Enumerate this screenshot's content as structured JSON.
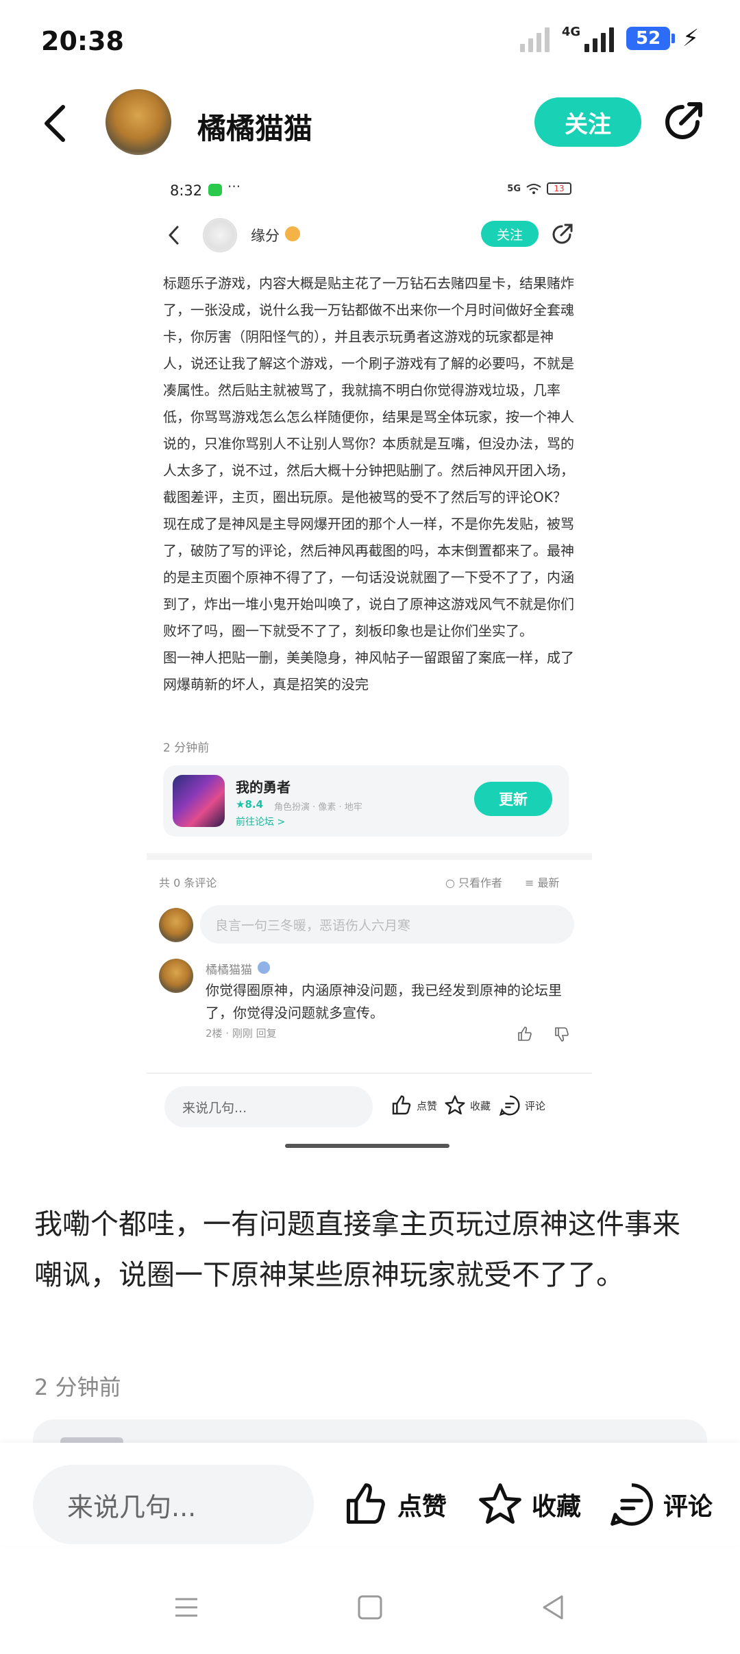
{
  "status_bar": {
    "time": "20:38",
    "network_label": "4G",
    "battery": "52",
    "icons": [
      "signal-icon",
      "mobile-data-icon",
      "battery-icon",
      "charging-icon"
    ]
  },
  "header": {
    "author_name": "橘橘猫猫",
    "follow_label": "关注",
    "icons": [
      "back-icon",
      "avatar",
      "share-icon"
    ]
  },
  "embedded_screenshot": {
    "time": "8:32",
    "dots": "···",
    "network": "5G",
    "battery": "13",
    "author_name": "缘分",
    "follow_label": "关注",
    "body_paragraphs": [
      "标题乐子游戏，内容大概是贴主花了一万钻石去赌四星卡，结果赌炸了，一张没成，说什么我一万钻都做不出来你一个月时间做好全套魂卡，你厉害（阴阳怪气的），并且表示玩勇者这游戏的玩家都是神人，说还让我了解这个游戏，一个刷子游戏有了解的必要吗，不就是凑属性。然后贴主就被骂了，我就搞不明白你觉得游戏垃圾，几率低，你骂骂游戏怎么怎么样随便你，结果是骂全体玩家，按一个神人说的，只准你骂别人不让别人骂你？本质就是互嘴，但没办法，骂的人太多了，说不过，然后大概十分钟把贴删了。然后神风开团入场，截图差评，主页，圈出玩原。是他被骂的受不了然后写的评论OK？现在成了是神风是主导网爆开团的那个人一样，不是你先发贴，被骂了，破防了写的评论，然后神风再截图的吗，本末倒置都来了。最神的是主页圈个原神不得了了，一句话没说就圈了一下受不了了，内涵到了，炸出一堆小鬼开始叫唤了，说白了原神这游戏风气不就是你们败坏了吗，圈一下就受不了了，刻板印象也是让你们坐实了。",
      "图一神人把贴一删，美美隐身，神风帖子一留跟留了案底一样，成了网爆萌新的坏人，真是招笑的没完"
    ],
    "time_ago": "2 分钟前",
    "game": {
      "name": "我的勇者",
      "rating": "★8.4",
      "tags": "角色扮演 · 像素 · 地牢",
      "forum_link": "前往论坛 >",
      "update_label": "更新"
    },
    "comments_header": {
      "count": "共 0 条评论",
      "only_author": "只看作者",
      "newest": "最新"
    },
    "comment_input_placeholder": "良言一句三冬暖，恶语伤人六月寒",
    "comment": {
      "author": "橘橘猫猫",
      "text": "你觉得圈原神，内涵原神没问题，我已经发到原神的论坛里了，你觉得没问题就多宣传。",
      "meta": "2楼 · 刚刚   回复"
    },
    "bottom_bar": {
      "input_placeholder": "来说几句...",
      "like": "点赞",
      "favorite": "收藏",
      "comment": "评论"
    }
  },
  "post": {
    "text": "我嘞个都哇，一有问题直接拿主页玩过原神这件事来嘲讽，说圈一下原神某些原神玩家就受不了了。",
    "time_ago": "2 分钟前"
  },
  "bottom_bar": {
    "input_placeholder": "来说几句...",
    "like": "点赞",
    "favorite": "收藏",
    "comment": "评论"
  },
  "system_nav": [
    "menu-icon",
    "home-icon",
    "back-triangle-icon"
  ],
  "colors": {
    "accent": "#19d2b5",
    "battery": "#2d6cf6"
  }
}
